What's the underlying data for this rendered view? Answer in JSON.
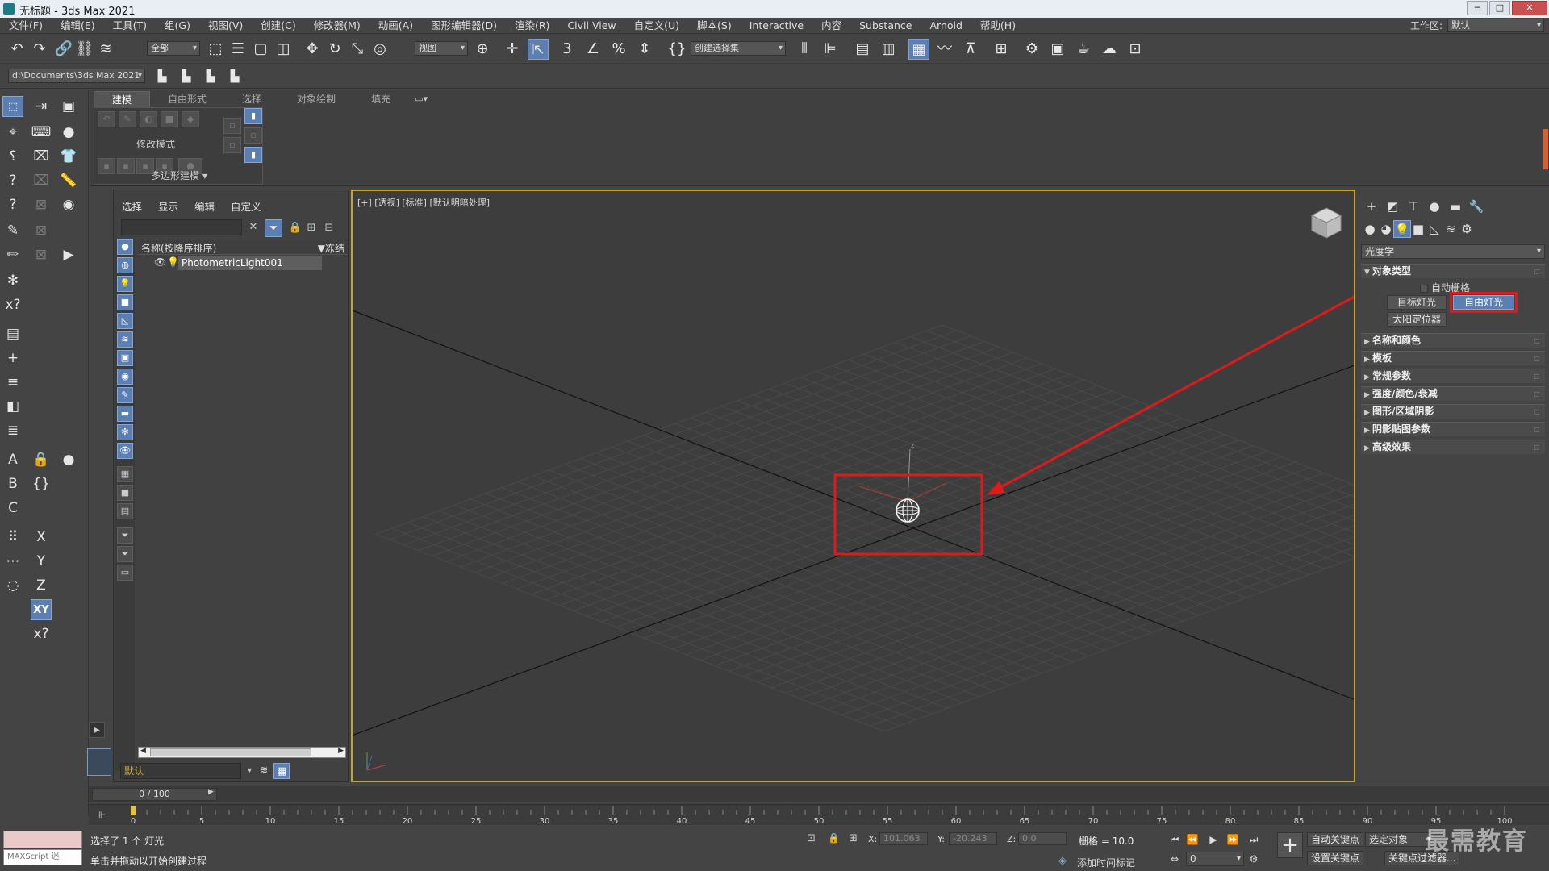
{
  "window": {
    "title": "无标题 - 3ds Max 2021",
    "btn_min": "0",
    "btn_max": "1",
    "btn_close": "r"
  },
  "menubar": {
    "items": [
      "文件(F)",
      "编辑(E)",
      "工具(T)",
      "组(G)",
      "视图(V)",
      "创建(C)",
      "修改器(M)",
      "动画(A)",
      "图形编辑器(D)",
      "渲染(R)",
      "Civil View",
      "自定义(U)",
      "脚本(S)",
      "Interactive",
      "内容",
      "Substance",
      "Arnold",
      "帮助(H)"
    ],
    "workspace_label": "工作区:",
    "workspace_value": "默认"
  },
  "toolbar": {
    "selection_filter": "全部",
    "ref_coord": "视图",
    "named_selection": "创建选择集",
    "project_path": "d:\\Documents\\3ds Max 2021"
  },
  "ribbon": {
    "tabs": [
      "建模",
      "自由形式",
      "选择",
      "对象绘制",
      "填充"
    ],
    "group_label": "修改模式",
    "group_footer": "多边形建模"
  },
  "explorer": {
    "menu": [
      "选择",
      "显示",
      "编辑",
      "自定义"
    ],
    "col_name": "名称(按降序排序)",
    "col_freeze": "▼冻结",
    "object_name": "PhotometricLight001",
    "layer": "默认"
  },
  "viewport": {
    "label": "[+] [透视] [标准] [默认明暗处理]"
  },
  "command_panel": {
    "category": "光度学",
    "rollout_object_type": "对象类型",
    "autogrid": "自动栅格",
    "btn_target_light": "目标灯光",
    "btn_free_light": "自由灯光",
    "btn_sun_positioner": "太阳定位器",
    "rollouts": [
      "名称和颜色",
      "模板",
      "常规参数",
      "强度/颜色/衰减",
      "图形/区域阴影",
      "阴影贴图参数",
      "高级效果"
    ]
  },
  "timeline": {
    "frame_display": "0 / 100",
    "ticks": [
      "0",
      "5",
      "10",
      "15",
      "20",
      "25",
      "30",
      "35",
      "40",
      "45",
      "50",
      "55",
      "60",
      "65",
      "70",
      "75",
      "80",
      "85",
      "90",
      "95",
      "100"
    ]
  },
  "status": {
    "maxscript": "MAXScript 迷",
    "line1": "选择了 1 个 灯光",
    "line2": "单击并拖动以开始创建过程",
    "x_label": "X:",
    "x_value": "101.063",
    "y_label": "Y:",
    "y_value": "-20.243",
    "z_label": "Z:",
    "z_value": "0.0",
    "grid": "栅格 = 10.0",
    "add_time_tag": "添加时间标记",
    "auto_key": "自动关键点",
    "set_key": "设置关键点",
    "selected_object": "选定对象",
    "key_filters": "关键点过滤器...",
    "frame_value": "0",
    "watermark": "最需教育"
  },
  "colors": {
    "accent": "#5b7fb3",
    "viewport_border": "#c6a430",
    "annotation_red": "#e01a1a"
  }
}
